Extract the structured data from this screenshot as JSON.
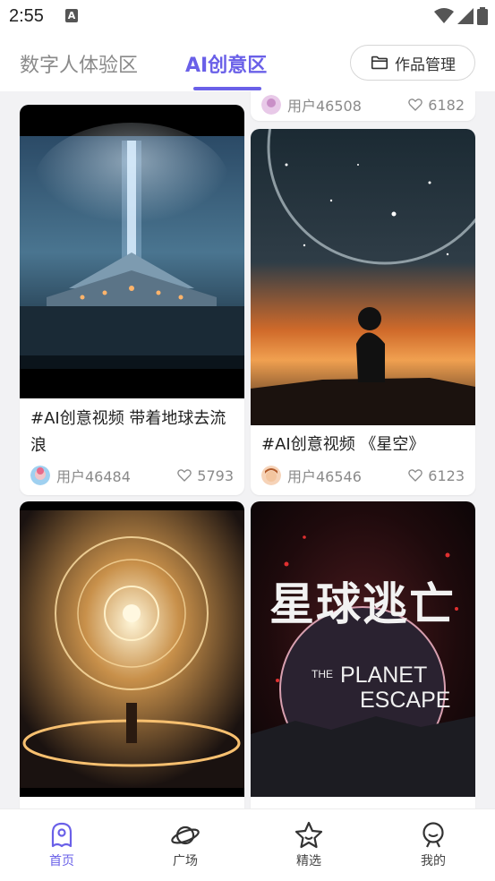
{
  "status_bar": {
    "time": "2:55",
    "notification_letter": "A"
  },
  "header": {
    "tabs": [
      {
        "label": "数字人体验区"
      },
      {
        "label": "AI创意区"
      }
    ],
    "manage_button": "作品管理"
  },
  "cards": [
    {
      "author": "用户46508",
      "likes": "6182",
      "image": "partially visible card top"
    },
    {
      "title": "#AI创意视频 带着地球去流浪",
      "author": "用户46484",
      "likes": "5793",
      "image": "glowing structure under light beam"
    },
    {
      "title": "#AI创意视频 《星空》",
      "author": "用户46546",
      "likes": "6123",
      "image": "boy sitting under planet sky"
    },
    {
      "image": "golden glowing circular portal"
    },
    {
      "image": "planet escape poster",
      "poster_title": "星球逃亡",
      "poster_sub_the": "THE",
      "poster_sub_planet": "PLANET",
      "poster_sub_escape": "ESCAPE"
    }
  ],
  "bottom_nav": [
    {
      "label": "首页",
      "icon": "home-icon",
      "active": true
    },
    {
      "label": "广场",
      "icon": "planet-icon",
      "active": false
    },
    {
      "label": "精选",
      "icon": "star-icon",
      "active": false
    },
    {
      "label": "我的",
      "icon": "profile-icon",
      "active": false
    }
  ],
  "colors": {
    "accent": "#6a60e8",
    "background": "#f2f2f4"
  }
}
